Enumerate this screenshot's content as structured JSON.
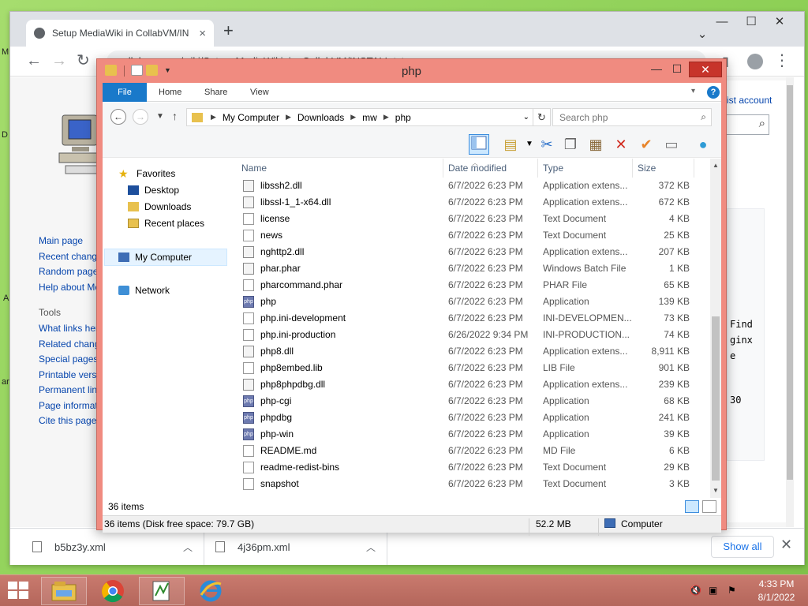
{
  "desktop": {
    "fragments": [
      "M",
      "D",
      "A",
      "ar"
    ]
  },
  "browser": {
    "tab_title": "Setup MediaWiki in CollabVM/IN",
    "tab_close": "×",
    "new_tab": "+",
    "url": "collabvm.com/wiki/Setup_MediaWiki_in_CollabVM/INSTALL.txt",
    "window_controls": {
      "minimize": "—",
      "maximize": "☐",
      "close": "✕"
    },
    "dropdown": "⌄",
    "menu": "⋮"
  },
  "wiki": {
    "account_link": "ist account",
    "nav": [
      "Main page",
      "Recent chang",
      "Random page",
      "Help about Me"
    ],
    "tools_heading": "Tools",
    "tools": [
      "What links her",
      "Related chang",
      "Special pages",
      "Printable vers",
      "Permanent lin",
      "Page informat",
      "Cite this page"
    ],
    "code_lines": [
      "Find",
      "ginx",
      "e",
      "30"
    ]
  },
  "downloads": {
    "items": [
      {
        "name": "b5bz3y.xml"
      },
      {
        "name": "4j36pm.xml"
      }
    ],
    "show_all": "Show all",
    "close": "✕"
  },
  "explorer": {
    "title": "php",
    "ribbon_tabs": [
      "File",
      "Home",
      "Share",
      "View"
    ],
    "help": "?",
    "address": [
      "My Computer",
      "Downloads",
      "mw",
      "php"
    ],
    "search_placeholder": "Search php",
    "nav_pane": {
      "favorites": "Favorites",
      "favorites_items": [
        "Desktop",
        "Downloads",
        "Recent places"
      ],
      "computer": "My Computer",
      "network": "Network"
    },
    "columns": [
      "Name",
      "Date modified",
      "Type",
      "Size"
    ],
    "files": [
      {
        "name": "libssh2.dll",
        "date": "6/7/2022 6:23 PM",
        "type": "Application extens...",
        "size": "372 KB",
        "icon": "dll"
      },
      {
        "name": "libssl-1_1-x64.dll",
        "date": "6/7/2022 6:23 PM",
        "type": "Application extens...",
        "size": "672 KB",
        "icon": "dll"
      },
      {
        "name": "license",
        "date": "6/7/2022 6:23 PM",
        "type": "Text Document",
        "size": "4 KB",
        "icon": "txt"
      },
      {
        "name": "news",
        "date": "6/7/2022 6:23 PM",
        "type": "Text Document",
        "size": "25 KB",
        "icon": "txt"
      },
      {
        "name": "nghttp2.dll",
        "date": "6/7/2022 6:23 PM",
        "type": "Application extens...",
        "size": "207 KB",
        "icon": "dll"
      },
      {
        "name": "phar.phar",
        "date": "6/7/2022 6:23 PM",
        "type": "Windows Batch File",
        "size": "1 KB",
        "icon": "dll"
      },
      {
        "name": "pharcommand.phar",
        "date": "6/7/2022 6:23 PM",
        "type": "PHAR File",
        "size": "65 KB",
        "icon": "txt"
      },
      {
        "name": "php",
        "date": "6/7/2022 6:23 PM",
        "type": "Application",
        "size": "139 KB",
        "icon": "app"
      },
      {
        "name": "php.ini-development",
        "date": "6/7/2022 6:23 PM",
        "type": "INI-DEVELOPMEN...",
        "size": "73 KB",
        "icon": "txt"
      },
      {
        "name": "php.ini-production",
        "date": "6/26/2022 9:34 PM",
        "type": "INI-PRODUCTION...",
        "size": "74 KB",
        "icon": "txt"
      },
      {
        "name": "php8.dll",
        "date": "6/7/2022 6:23 PM",
        "type": "Application extens...",
        "size": "8,911 KB",
        "icon": "dll"
      },
      {
        "name": "php8embed.lib",
        "date": "6/7/2022 6:23 PM",
        "type": "LIB File",
        "size": "901 KB",
        "icon": "txt"
      },
      {
        "name": "php8phpdbg.dll",
        "date": "6/7/2022 6:23 PM",
        "type": "Application extens...",
        "size": "239 KB",
        "icon": "dll"
      },
      {
        "name": "php-cgi",
        "date": "6/7/2022 6:23 PM",
        "type": "Application",
        "size": "68 KB",
        "icon": "app"
      },
      {
        "name": "phpdbg",
        "date": "6/7/2022 6:23 PM",
        "type": "Application",
        "size": "241 KB",
        "icon": "app"
      },
      {
        "name": "php-win",
        "date": "6/7/2022 6:23 PM",
        "type": "Application",
        "size": "39 KB",
        "icon": "app"
      },
      {
        "name": "README.md",
        "date": "6/7/2022 6:23 PM",
        "type": "MD File",
        "size": "6 KB",
        "icon": "txt"
      },
      {
        "name": "readme-redist-bins",
        "date": "6/7/2022 6:23 PM",
        "type": "Text Document",
        "size": "29 KB",
        "icon": "txt"
      },
      {
        "name": "snapshot",
        "date": "6/7/2022 6:23 PM",
        "type": "Text Document",
        "size": "3 KB",
        "icon": "txt"
      }
    ],
    "item_count": "36 items",
    "status_left": "36 items (Disk free space: 79.7 GB)",
    "status_size": "52.2 MB",
    "status_location": "Computer",
    "app_icon_text": "php"
  },
  "taskbar": {
    "time": "4:33 PM",
    "date": "8/1/2022",
    "colors": {
      "bar": "#c97a6e",
      "explorer_frame": "#f08b80",
      "accent": "#1979ca"
    }
  }
}
